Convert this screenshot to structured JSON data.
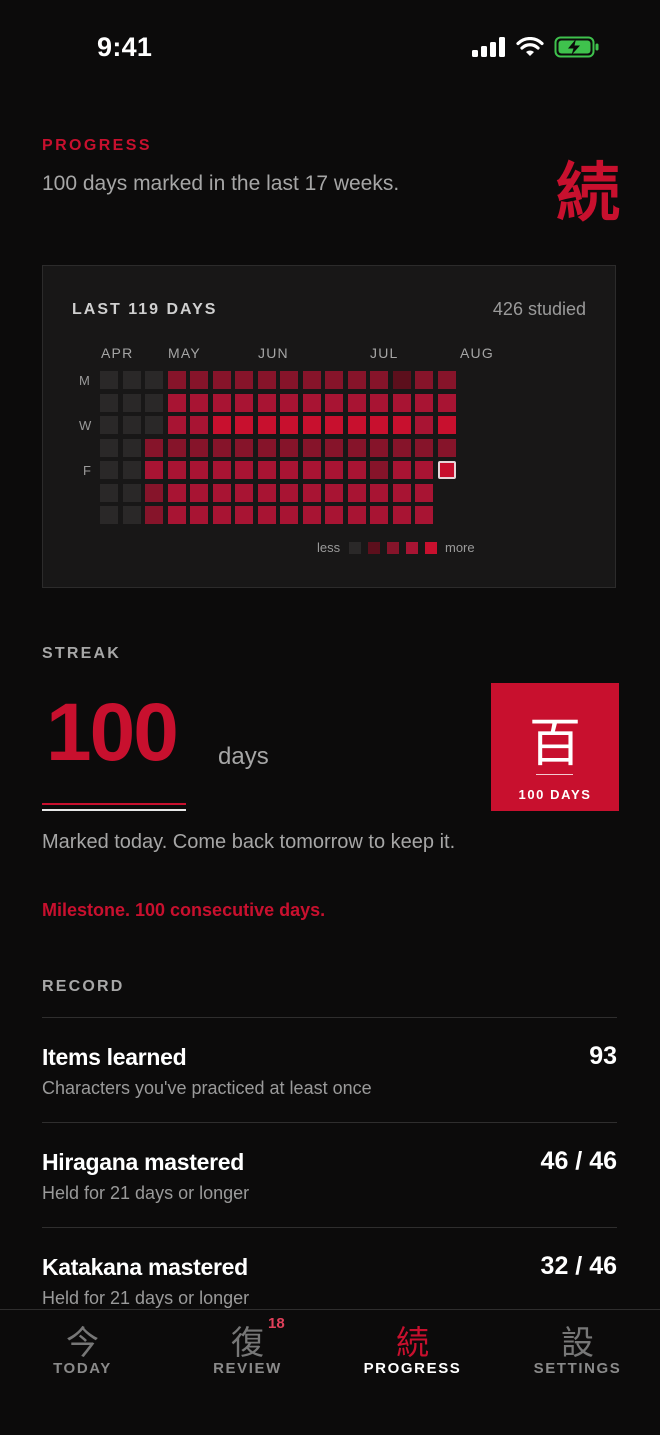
{
  "status_bar": {
    "time": "9:41"
  },
  "header": {
    "eyebrow": "PROGRESS",
    "subtitle": "100 days marked in the last 17 weeks.",
    "kanji": "続"
  },
  "heatmap": {
    "title": "LAST 119 DAYS",
    "studied": "426 studied",
    "months": [
      "APR",
      "MAY",
      "JUN",
      "JUL",
      "AUG"
    ],
    "weekdays": [
      "M",
      "W",
      "F"
    ],
    "legend_less": "less",
    "legend_more": "more",
    "colors": [
      "#2a2828",
      "#5c0f1c",
      "#86142a",
      "#a81433",
      "#c8102e"
    ],
    "levels": [
      [
        0,
        0,
        0,
        2,
        2,
        2,
        2,
        2,
        2,
        2,
        2,
        2,
        2,
        1,
        2,
        2
      ],
      [
        0,
        0,
        0,
        3,
        3,
        3,
        3,
        3,
        3,
        3,
        3,
        3,
        3,
        3,
        3,
        3
      ],
      [
        0,
        0,
        0,
        3,
        3,
        4,
        4,
        4,
        4,
        4,
        4,
        4,
        4,
        4,
        3,
        4
      ],
      [
        0,
        0,
        2,
        2,
        2,
        2,
        2,
        2,
        2,
        2,
        2,
        2,
        2,
        2,
        2,
        2
      ],
      [
        0,
        0,
        3,
        3,
        3,
        3,
        3,
        3,
        3,
        3,
        3,
        3,
        2,
        3,
        3,
        "today"
      ],
      [
        0,
        0,
        2,
        3,
        3,
        3,
        3,
        3,
        3,
        3,
        3,
        3,
        3,
        3,
        3
      ],
      [
        0,
        0,
        2,
        3,
        3,
        3,
        3,
        3,
        3,
        3,
        3,
        3,
        3,
        3,
        3
      ]
    ],
    "today_cell": "Aug, Friday"
  },
  "streak": {
    "label": "STREAK",
    "count": "100",
    "unit": "days",
    "badge_kanji": "百",
    "badge_text": "100 DAYS",
    "message": "Marked today. Come back tomorrow to keep it.",
    "milestone": "Milestone. 100 consecutive days."
  },
  "record": {
    "label": "RECORD",
    "items": [
      {
        "title": "Items learned",
        "subtitle": "Characters you've practiced at least once",
        "value": "93"
      },
      {
        "title": "Hiragana mastered",
        "subtitle": "Held for 21 days or longer",
        "value": "46 / 46"
      },
      {
        "title": "Katakana mastered",
        "subtitle": "Held for 21 days or longer",
        "value": "32 / 46"
      }
    ]
  },
  "tabs": [
    {
      "icon": "今",
      "label": "TODAY",
      "active": false
    },
    {
      "icon": "復",
      "label": "REVIEW",
      "badge": "18",
      "active": false
    },
    {
      "icon": "続",
      "label": "PROGRESS",
      "active": true
    },
    {
      "icon": "設",
      "label": "SETTINGS",
      "active": false
    }
  ]
}
